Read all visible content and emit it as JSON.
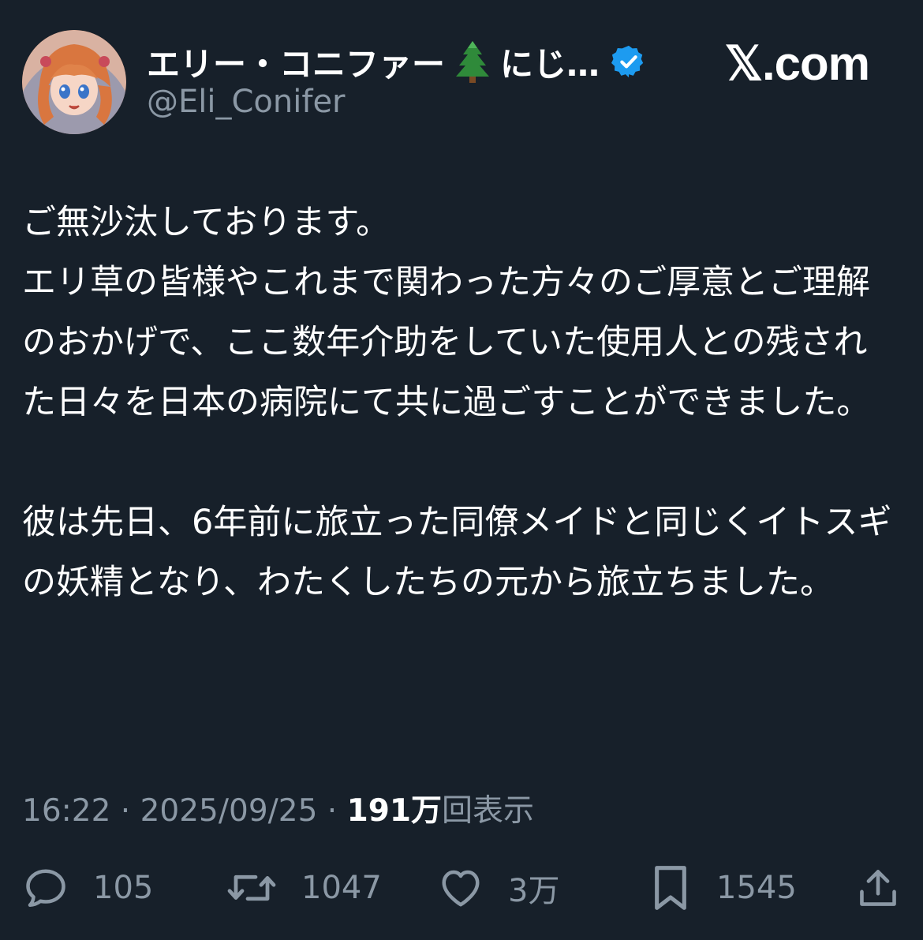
{
  "header": {
    "display_name": "エリー・コニファー",
    "display_name_suffix": "にじ…",
    "handle": "@Eli_Conifer",
    "brand": "𝕏.com"
  },
  "post": {
    "paragraph1": "ご無沙汰しております。\nエリ草の皆様やこれまで関わった方々のご厚意とご理解のおかげで、ここ数年介助をしていた使用人との残された日々を日本の病院にて共に過ごすことができました。",
    "paragraph2": "彼は先日、6年前に旅立った同僚メイドと同じくイトスギの妖精となり、わたくしたちの元から旅立ちました。"
  },
  "meta": {
    "time": "16:22",
    "date": "2025/09/25",
    "views_count": "191万",
    "views_label": "回表示",
    "separator": " · "
  },
  "actions": {
    "replies": "105",
    "reposts": "1047",
    "likes": "3万",
    "bookmarks": "1545"
  },
  "colors": {
    "background": "#17202a",
    "muted": "#8b98a5",
    "verified": "#1d9bf0"
  },
  "icons": [
    "tree-icon",
    "verified-badge-icon",
    "reply-icon",
    "repost-icon",
    "like-icon",
    "bookmark-icon",
    "share-icon"
  ]
}
